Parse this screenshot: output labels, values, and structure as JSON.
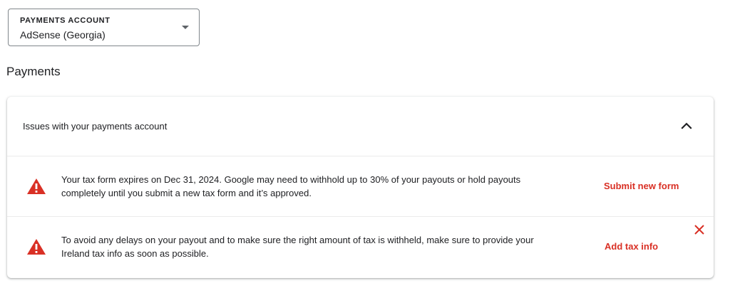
{
  "account_selector": {
    "label": "PAYMENTS ACCOUNT",
    "value": "AdSense (Georgia)"
  },
  "section": {
    "title": "Payments"
  },
  "issues_card": {
    "title": "Issues with your payments account",
    "expanded": true,
    "issues": [
      {
        "icon": "warning-icon",
        "text": "Your tax form expires on Dec 31, 2024. Google may need to withhold up to 30% of your payouts or hold payouts completely until you submit a new tax form and it’s approved.",
        "action": "Submit new form"
      },
      {
        "icon": "warning-icon",
        "text": "To avoid any delays on your payout and to make sure the right amount of tax is withheld, make sure to provide your Ireland tax info as soon as possible.",
        "action": "Add tax info",
        "dismissible": true
      }
    ]
  },
  "colors": {
    "accent_red": "#d93025",
    "text": "#202124",
    "border": "#80868b"
  }
}
